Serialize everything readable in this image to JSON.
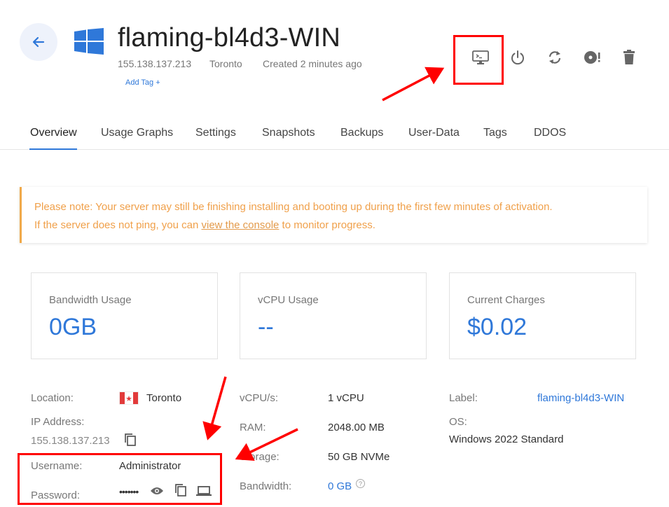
{
  "header": {
    "title": "flaming-bl4d3-WIN",
    "ip": "155.138.137.213",
    "location": "Toronto",
    "created": "Created 2 minutes ago",
    "add_tag": "Add Tag +"
  },
  "toolbar": {
    "icons": [
      "console-icon",
      "power-icon",
      "restart-icon",
      "iso-icon",
      "trash-icon"
    ]
  },
  "tabs": [
    "Overview",
    "Usage Graphs",
    "Settings",
    "Snapshots",
    "Backups",
    "User-Data",
    "Tags",
    "DDOS"
  ],
  "notice": {
    "line1": "Please note: Your server may still be finishing installing and booting up during the first few minutes of activation.",
    "line2_pre": "If the server does not ping, you can ",
    "line2_link": "view the console",
    "line2_post": " to monitor progress."
  },
  "cards": [
    {
      "label": "Bandwidth Usage",
      "value": "0GB"
    },
    {
      "label": "vCPU Usage",
      "value": "--"
    },
    {
      "label": "Current Charges",
      "value": "$0.02"
    }
  ],
  "details": {
    "location_label": "Location:",
    "location_value": "Toronto",
    "ip_label": "IP Address:",
    "ip_value": "155.138.137.213",
    "username_label": "Username:",
    "username_value": "Administrator",
    "password_label": "Password:",
    "password_value": "•••••••",
    "vcpu_label": "vCPU/s:",
    "vcpu_value": "1 vCPU",
    "ram_label": "RAM:",
    "ram_value": "2048.00 MB",
    "storage_label": "Storage:",
    "storage_value": "50 GB NVMe",
    "bandwidth_label": "Bandwidth:",
    "bandwidth_value": "0 GB",
    "label_label": "Label:",
    "label_value": "flaming-bl4d3-WIN",
    "os_label": "OS:",
    "os_value": "Windows 2022 Standard"
  },
  "colors": {
    "accent": "#2f78d9",
    "warning": "#f0a94a",
    "annotation": "#ff0000"
  }
}
